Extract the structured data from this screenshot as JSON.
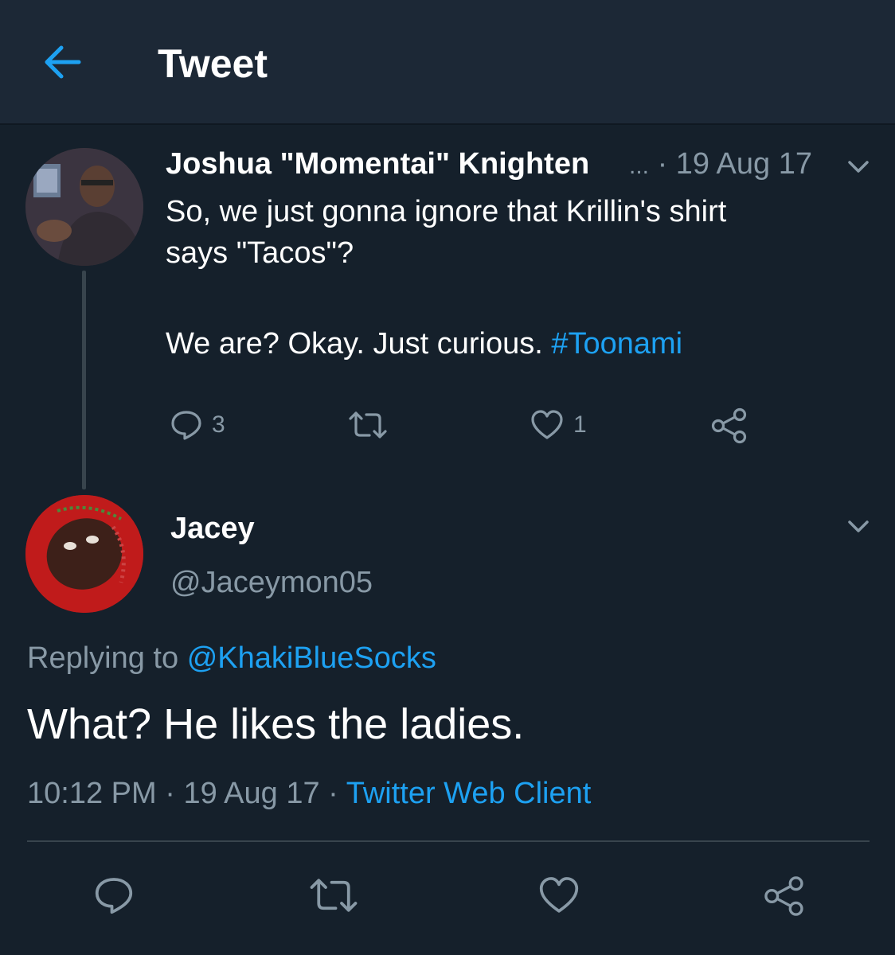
{
  "header": {
    "title": "Tweet",
    "back_icon": "arrow-left-icon",
    "accent": "#1da1f2"
  },
  "parent_tweet": {
    "author_name": "Joshua \"Momentai\" Knighten",
    "ellipsis": "...",
    "separator": "·",
    "date": "19 Aug 17",
    "text_lines": [
      "So, we just gonna ignore that Krillin's shirt",
      "says \"Tacos\"?"
    ],
    "text_line3": "We are? Okay. Just curious.",
    "hashtag": "#Toonami",
    "reply_count": "3",
    "retweet_count": "",
    "like_count": "1"
  },
  "reply_tweet": {
    "author_name": "Jacey",
    "handle": "@Jaceymon05",
    "replying_prefix": "Replying to",
    "replying_to": "@KhakiBlueSocks",
    "text": "What? He likes the ladies.",
    "time": "10:12 PM",
    "date": "19 Aug 17",
    "client": "Twitter Web Client",
    "meta_separator": "·"
  },
  "colors": {
    "background": "#15202b",
    "header_background": "#1c2836",
    "secondary_text": "#8899a6",
    "link": "#1da1f2",
    "line": "#38444d"
  }
}
